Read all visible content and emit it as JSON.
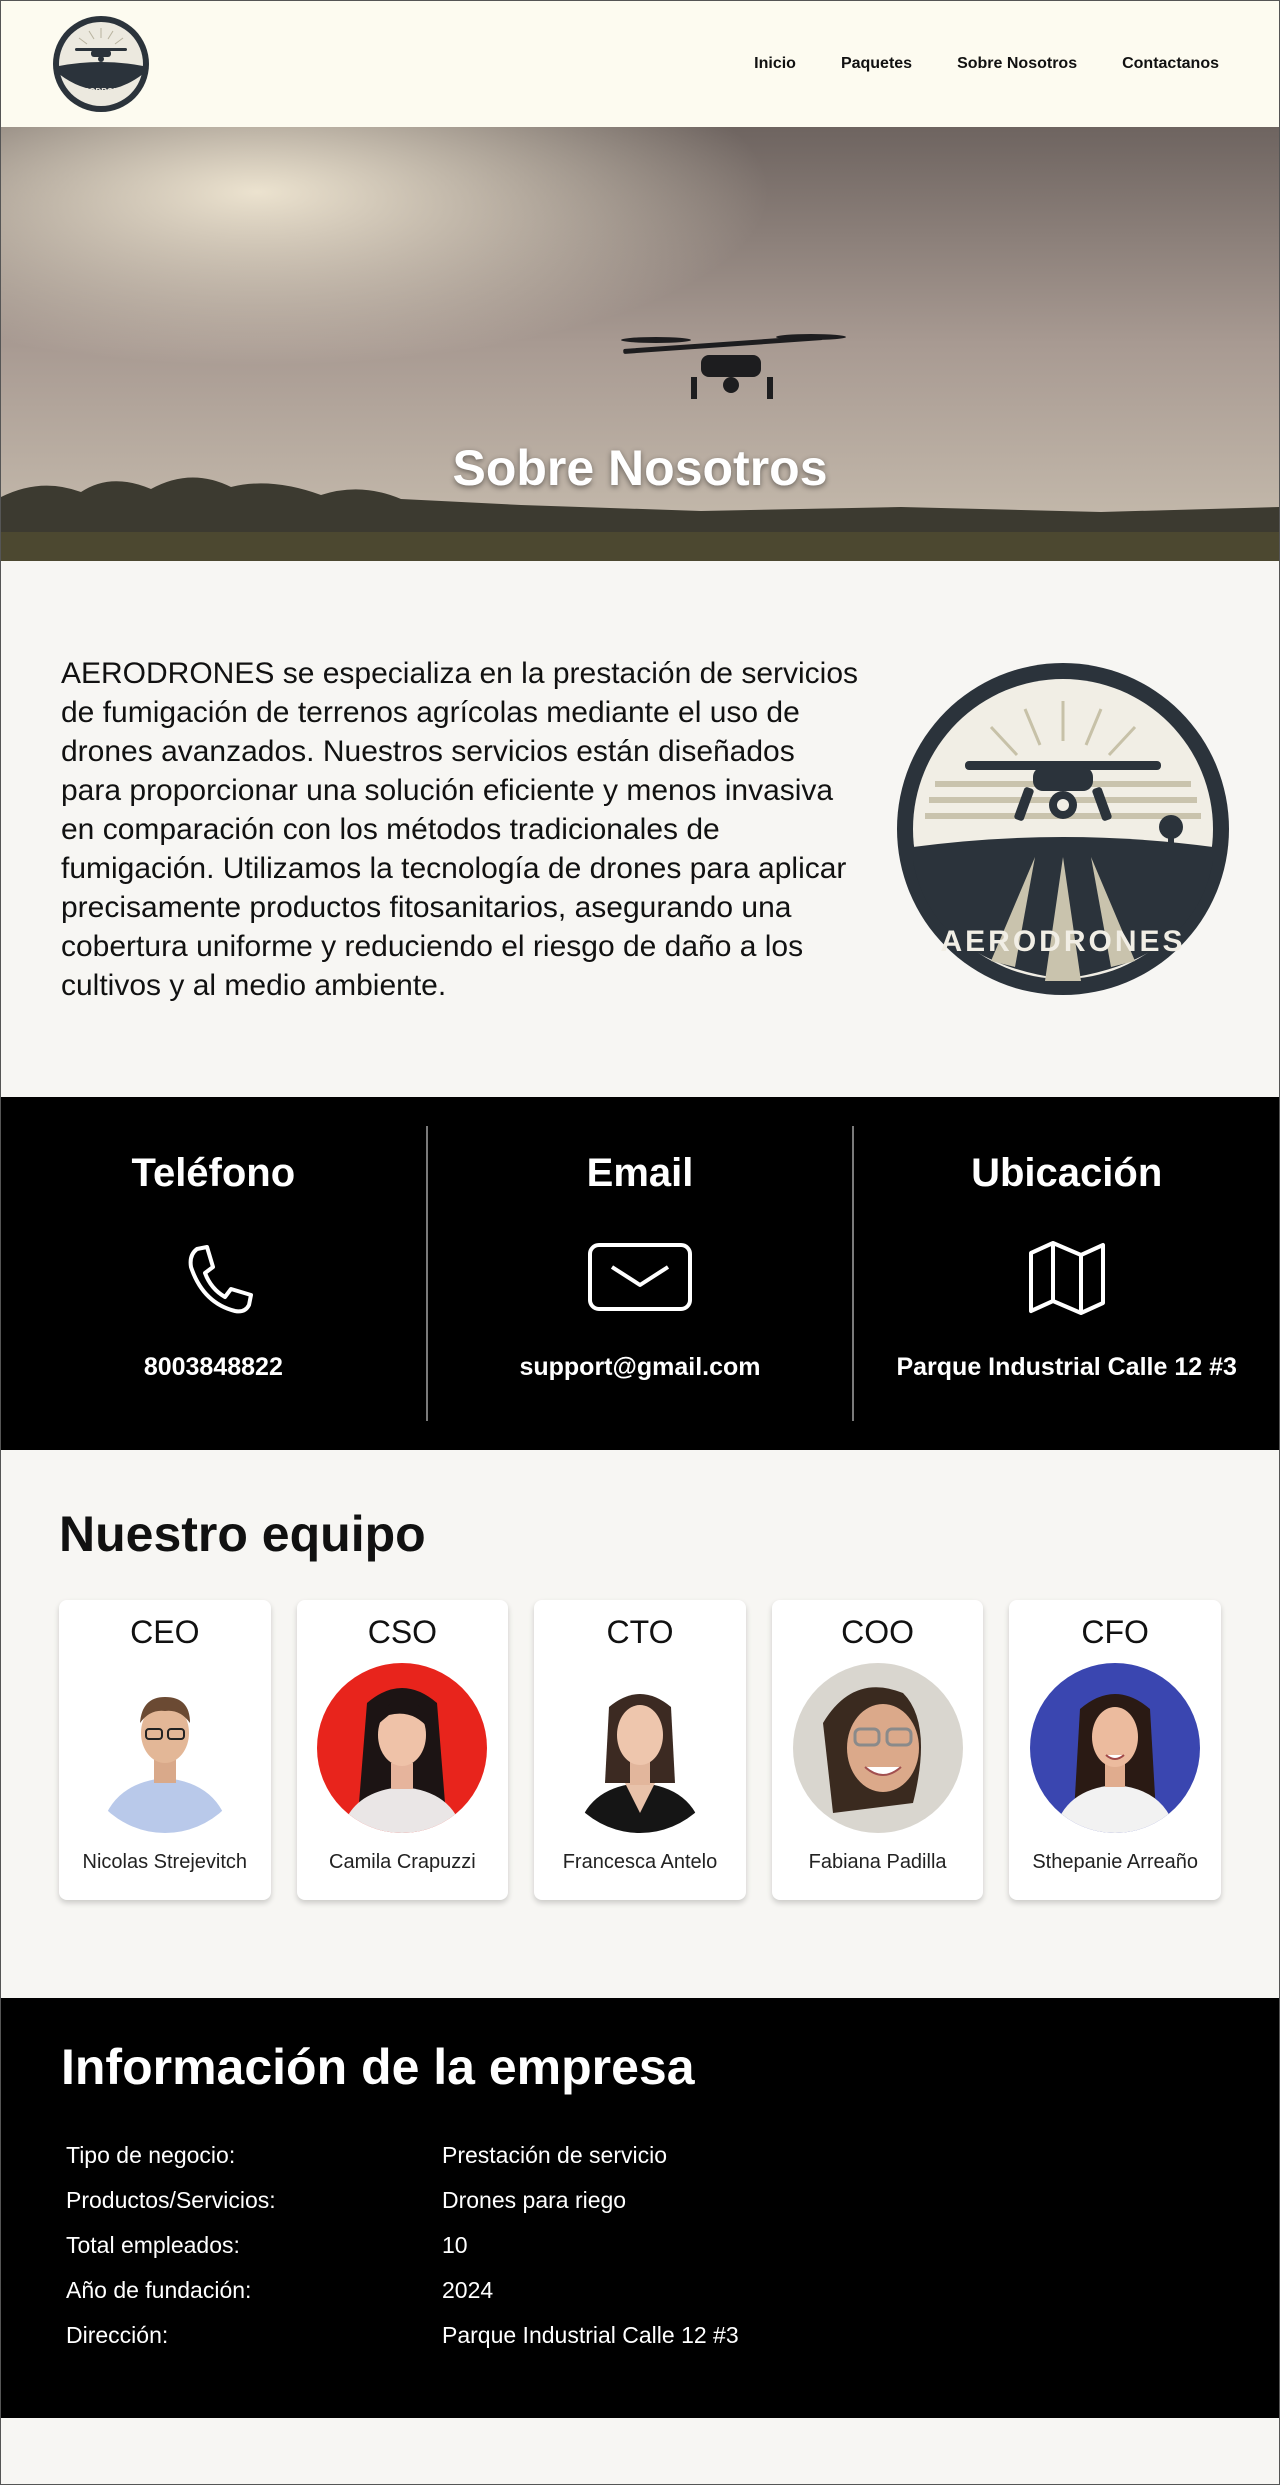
{
  "brand": {
    "name": "AERODRONES"
  },
  "nav": {
    "items": [
      "Inicio",
      "Paquetes",
      "Sobre Nosotros",
      "Contactanos"
    ]
  },
  "hero": {
    "title": "Sobre Nosotros"
  },
  "about": {
    "text": "AERODRONES se especializa en la prestación de servicios de fumigación de terrenos agrícolas mediante el uso de drones avanzados. Nuestros servicios están diseñados para proporcionar una solución eficiente y menos invasiva en comparación con los métodos tradicionales de fumigación. Utilizamos la tecnología de drones para aplicar precisamente productos fitosanitarios, asegurando una cobertura uniforme y reduciendo el riesgo de daño a los cultivos y al medio ambiente."
  },
  "contact": {
    "phone": {
      "title": "Teléfono",
      "value": "8003848822",
      "icon": "phone-icon"
    },
    "email": {
      "title": "Email",
      "value": "support@gmail.com",
      "icon": "envelope-icon"
    },
    "location": {
      "title": "Ubicación",
      "value": "Parque Industrial Calle 12 #3",
      "icon": "map-icon"
    }
  },
  "team": {
    "title": "Nuestro equipo",
    "members": [
      {
        "role": "CEO",
        "name": "Nicolas Strejevitch",
        "bg": "#ffffff"
      },
      {
        "role": "CSO",
        "name": "Camila Crapuzzi",
        "bg": "#e8241c"
      },
      {
        "role": "CTO",
        "name": "Francesca Antelo",
        "bg": "#ffffff"
      },
      {
        "role": "COO",
        "name": "Fabiana Padilla",
        "bg": "#d9d6cf"
      },
      {
        "role": "CFO",
        "name": "Sthepanie Arreaño",
        "bg": "#3a46b0"
      }
    ]
  },
  "company": {
    "title": "Información de la empresa",
    "rows": [
      {
        "label": "Tipo de negocio:",
        "value": "Prestación de servicio"
      },
      {
        "label": "Productos/Servicios:",
        "value": "Drones para riego"
      },
      {
        "label": "Total empleados:",
        "value": "10"
      },
      {
        "label": "Año de fundación:",
        "value": "2024"
      },
      {
        "label": "Dirección:",
        "value": "Parque Industrial Calle 12 #3"
      }
    ]
  }
}
